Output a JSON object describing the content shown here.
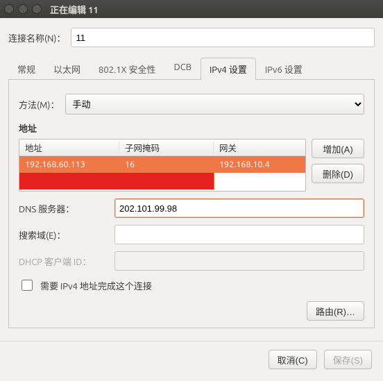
{
  "window": {
    "title": "正在编辑 11"
  },
  "connection": {
    "label": "连接名称(N)：",
    "value": "11"
  },
  "tabs": {
    "items": [
      "常规",
      "以太网",
      "802.1X 安全性",
      "DCB",
      "IPv4 设置",
      "IPv6 设置"
    ],
    "active_index": 4
  },
  "method": {
    "label": "方法(M)：",
    "value": "手动"
  },
  "addresses": {
    "title": "地址",
    "headers": {
      "addr": "地址",
      "mask": "子网掩码",
      "gw": "网关"
    },
    "rows": [
      {
        "addr": "192.168.60.113",
        "mask": "16",
        "gw": "192.168.10.4"
      }
    ],
    "add_label": "增加(A)",
    "del_label": "删除(D)"
  },
  "dns": {
    "label": "DNS 服务器：",
    "value": "202.101.99.98"
  },
  "search": {
    "label": "搜索域(E)：",
    "value": ""
  },
  "dhcp_client": {
    "label": "DHCP 客户端 ID：",
    "value": ""
  },
  "require_ipv4": {
    "label": "需要 IPv4 地址完成这个连接",
    "checked": false
  },
  "routes": {
    "label": "路由(R)…"
  },
  "footer": {
    "cancel": "取消(C)",
    "save": "保存(S)"
  }
}
